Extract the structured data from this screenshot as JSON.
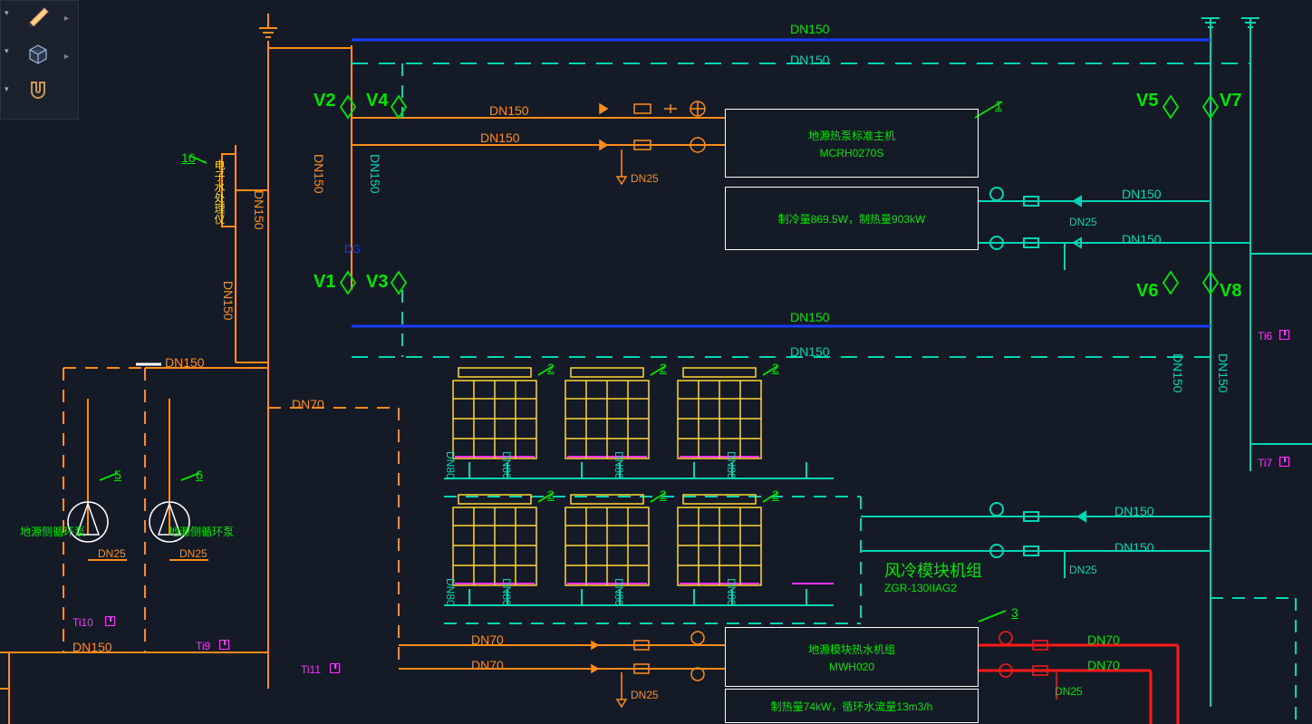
{
  "toolbar": {
    "items": [
      "pencil",
      "cube",
      "magnet"
    ]
  },
  "pipe_sizes": {
    "dn150": "DN150",
    "dn80": "DN80",
    "dn70": "DN70",
    "dn25": "DN25"
  },
  "valves": {
    "v1": "V1",
    "v2": "V2",
    "v3": "V3",
    "v4": "V4",
    "v5": "V5",
    "v6": "V6",
    "v7": "V7",
    "v8": "V8"
  },
  "callouts": {
    "c1": "1",
    "c2": "2",
    "c3": "3",
    "c5": "5",
    "c6": "6",
    "c16": "16"
  },
  "temp_tags": {
    "ti6": "Ti6",
    "ti7": "Ti7",
    "ti9": "Ti9",
    "ti10": "Ti10",
    "ti11": "Ti11"
  },
  "equipment": {
    "gshp": {
      "title": "地源热泵标准主机",
      "model": "MCRH0270S",
      "spec": "制冷量869.5W，制热量903kW"
    },
    "aircooled": {
      "title": "风冷模块机组",
      "model": "ZGR-130IIAG2"
    },
    "hotwater": {
      "title": "地源模块热水机组",
      "model": "MWH020",
      "spec": "制热量74kW，循环水流量13m3/h"
    }
  },
  "pumps": {
    "p1": "地源侧循环泵",
    "p2": "地源侧循环泵"
  },
  "misc": {
    "meter": "电子水处理仪",
    "dg": "DG"
  }
}
